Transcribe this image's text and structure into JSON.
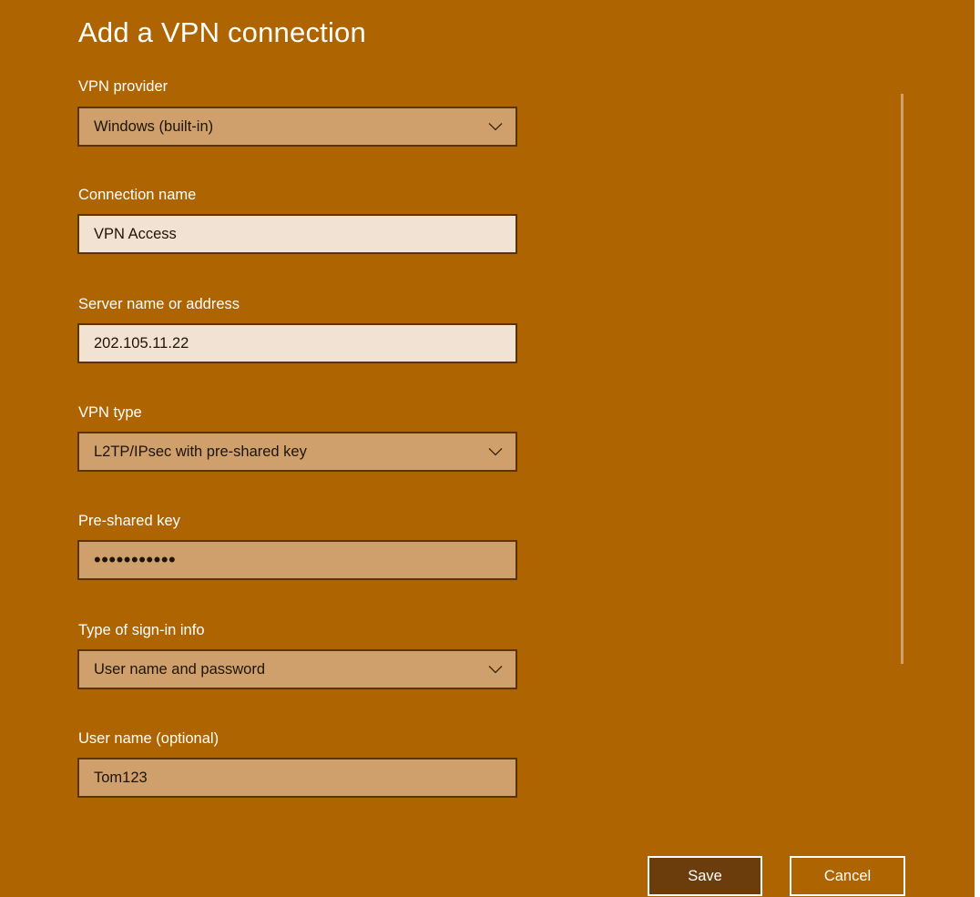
{
  "dialog": {
    "title": "Add a VPN connection"
  },
  "fields": {
    "vpn_provider": {
      "label": "VPN provider",
      "value": "Windows (built-in)"
    },
    "connection_name": {
      "label": "Connection name",
      "value": "VPN Access"
    },
    "server": {
      "label": "Server name or address",
      "value": "202.105.11.22"
    },
    "vpn_type": {
      "label": "VPN type",
      "value": "L2TP/IPsec with pre-shared key"
    },
    "pre_shared_key": {
      "label": "Pre-shared key",
      "value": "•••••••••••"
    },
    "sign_in_type": {
      "label": "Type of sign-in info",
      "value": "User name and password"
    },
    "user_name": {
      "label": "User name (optional)",
      "value": "Tom123"
    }
  },
  "buttons": {
    "save": "Save",
    "cancel": "Cancel"
  },
  "colors": {
    "background": "#ae6400",
    "field_dark": "#cfa06b",
    "field_light": "#f1e2d3",
    "border": "#5a3405",
    "save_button": "#6b3d0c"
  },
  "icons": {
    "dropdown": "chevron-down-icon"
  }
}
